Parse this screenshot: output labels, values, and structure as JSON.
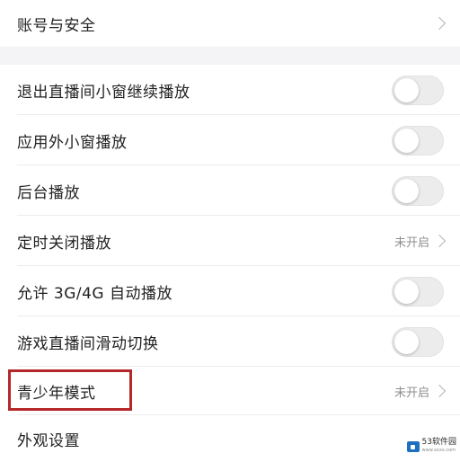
{
  "account": {
    "label": "账号与安全"
  },
  "settings": [
    {
      "label": "退出直播间小窗继续播放",
      "type": "toggle",
      "on": false
    },
    {
      "label": "应用外小窗播放",
      "type": "toggle",
      "on": false
    },
    {
      "label": "后台播放",
      "type": "toggle",
      "on": false
    },
    {
      "label": "定时关闭播放",
      "type": "status",
      "status": "未开启"
    },
    {
      "label": "允许 3G/4G 自动播放",
      "type": "toggle",
      "on": false
    },
    {
      "label": "游戏直播间滑动切换",
      "type": "toggle",
      "on": false
    },
    {
      "label": "青少年模式",
      "type": "status",
      "status": "未开启"
    },
    {
      "label": "外观设置",
      "type": "link"
    }
  ],
  "watermark": {
    "brand": "53软件园",
    "url": "www.xxxx.com"
  },
  "colors": {
    "highlight_border": "#b5282a",
    "toggle_off": "#ececec",
    "page_bg": "#f4f4f6"
  }
}
